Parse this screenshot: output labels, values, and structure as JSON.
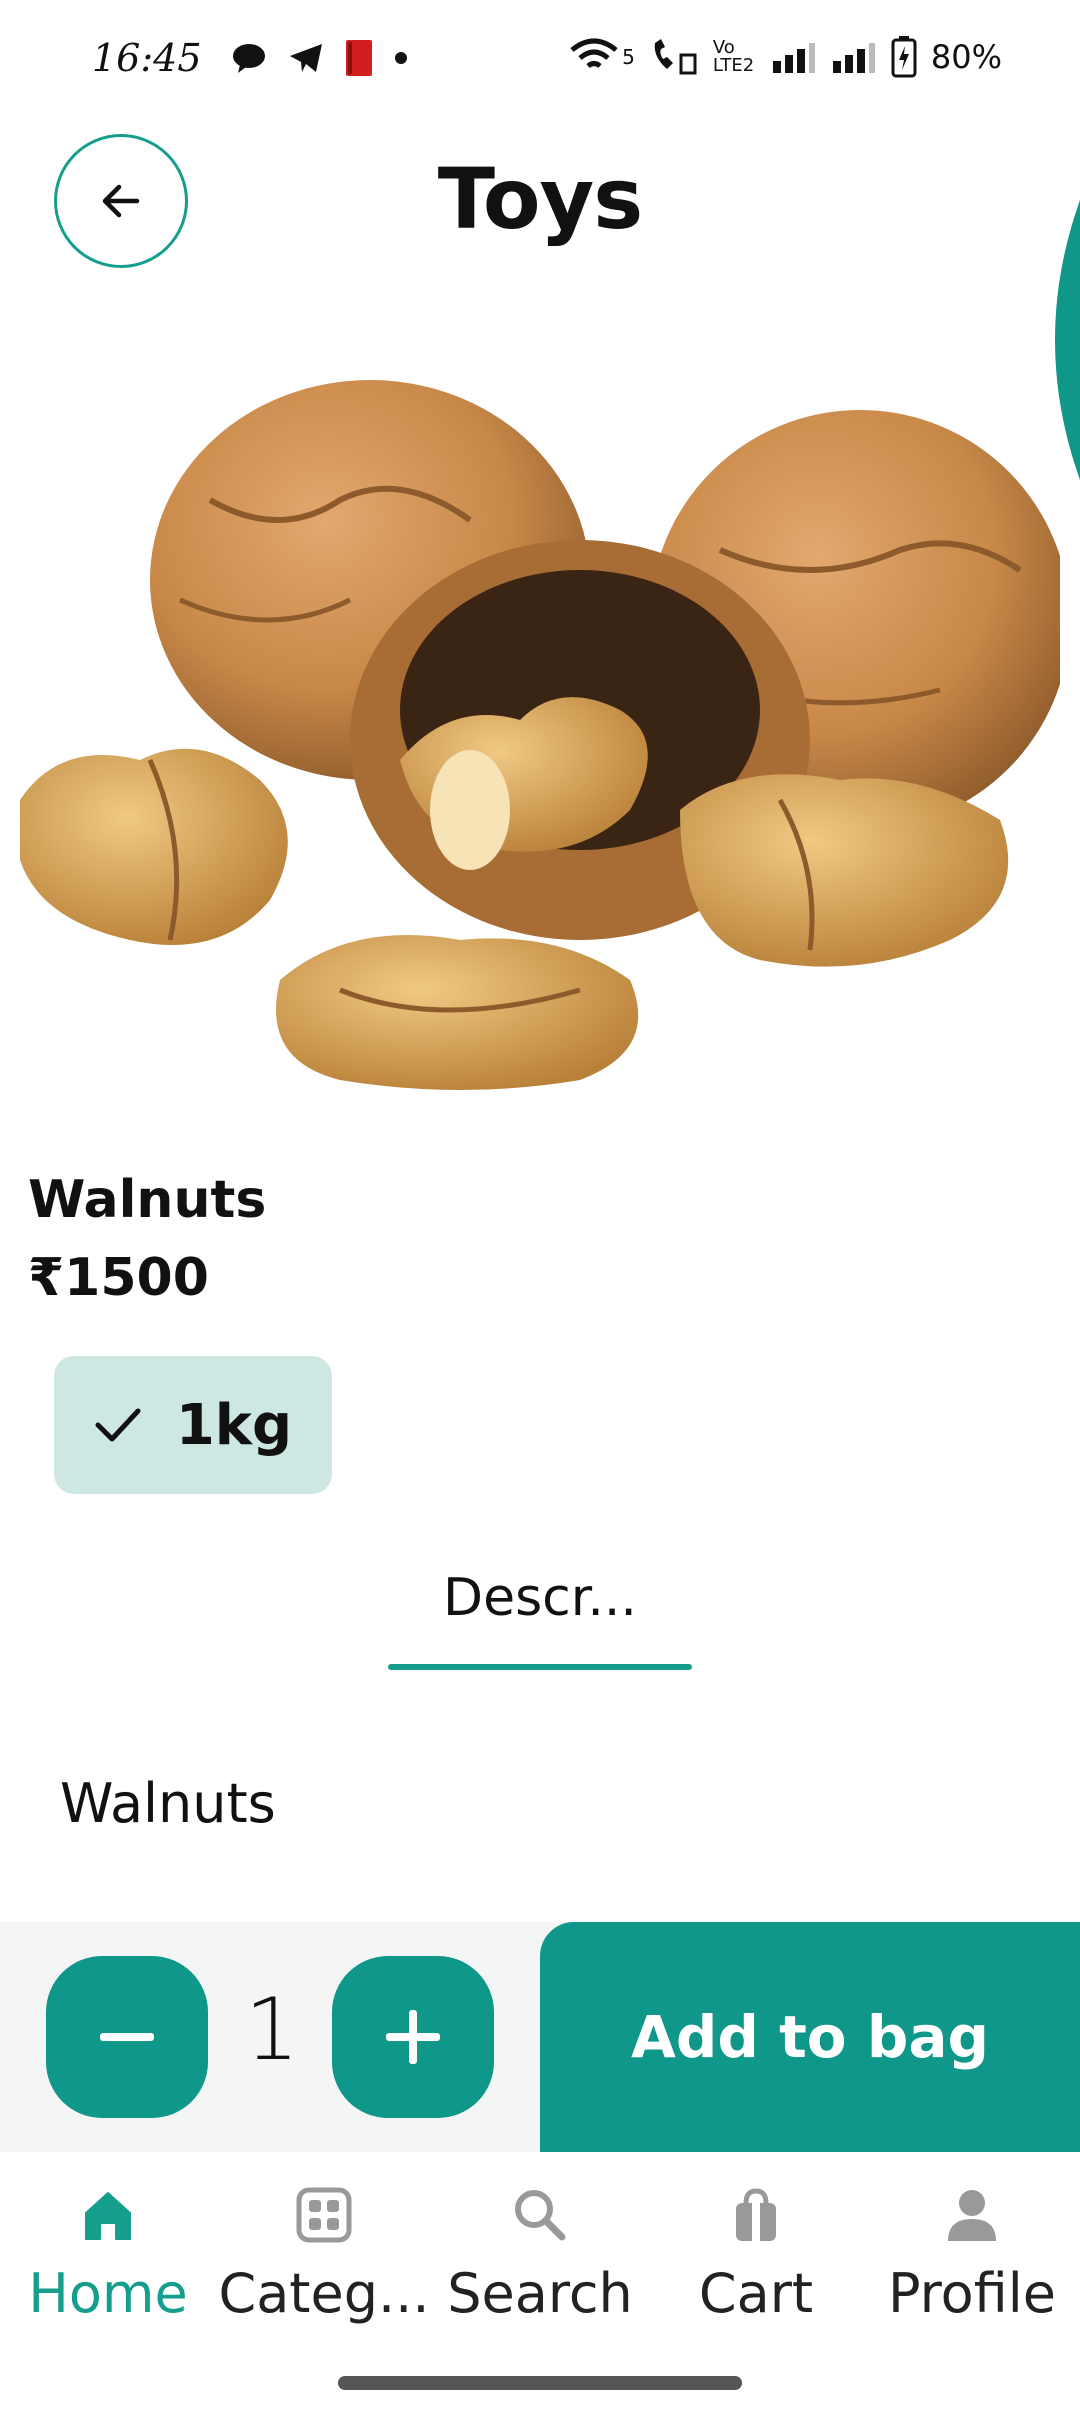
{
  "status_bar": {
    "time": "16:45",
    "network_labels": [
      "5",
      "Vo LTE2"
    ],
    "battery": "80%"
  },
  "header": {
    "title": "Toys",
    "back_icon": "arrow-left-icon"
  },
  "product": {
    "name": "Walnuts",
    "price": "₹1500",
    "variant": "1kg"
  },
  "tabs": [
    {
      "label": "Descr..."
    }
  ],
  "description": {
    "text": "Walnuts"
  },
  "cart_controls": {
    "quantity": "1",
    "add_label": "Add to bag"
  },
  "bottom_nav": {
    "items": [
      {
        "label": "Home",
        "icon": "home-icon",
        "active": true
      },
      {
        "label": "Categ...",
        "icon": "grid-icon",
        "active": false
      },
      {
        "label": "Search",
        "icon": "search-icon",
        "active": false
      },
      {
        "label": "Cart",
        "icon": "bag-icon",
        "active": false
      },
      {
        "label": "Profile",
        "icon": "person-icon",
        "active": false
      }
    ]
  },
  "colors": {
    "accent": "#169e8c",
    "button": "#0f978a",
    "chip_bg": "#cde8e3"
  }
}
